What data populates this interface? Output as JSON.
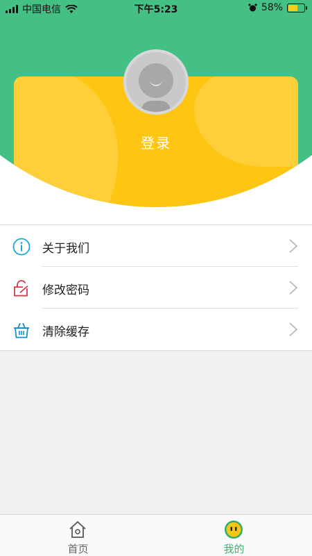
{
  "status_bar": {
    "carrier": "中国电信",
    "time": "下午5:23",
    "battery_percent": "58%",
    "battery_level": 0.58,
    "battery_color": "#f3d11a"
  },
  "profile": {
    "login_label": "登录",
    "header_color": "#45c085",
    "card_color": "#ffc20e"
  },
  "menu": {
    "items": [
      {
        "label": "关于我们",
        "icon": "info-icon",
        "icon_color": "#1fa6d6"
      },
      {
        "label": "修改密码",
        "icon": "lock-edit-icon",
        "icon_color": "#d9364a"
      },
      {
        "label": "清除缓存",
        "icon": "basket-icon",
        "icon_color": "#1a8fc9"
      }
    ]
  },
  "tabbar": {
    "tabs": [
      {
        "label": "首页",
        "icon": "home-icon",
        "active": false
      },
      {
        "label": "我的",
        "icon": "face-icon",
        "active": true
      }
    ],
    "active_color": "#3ab574"
  }
}
